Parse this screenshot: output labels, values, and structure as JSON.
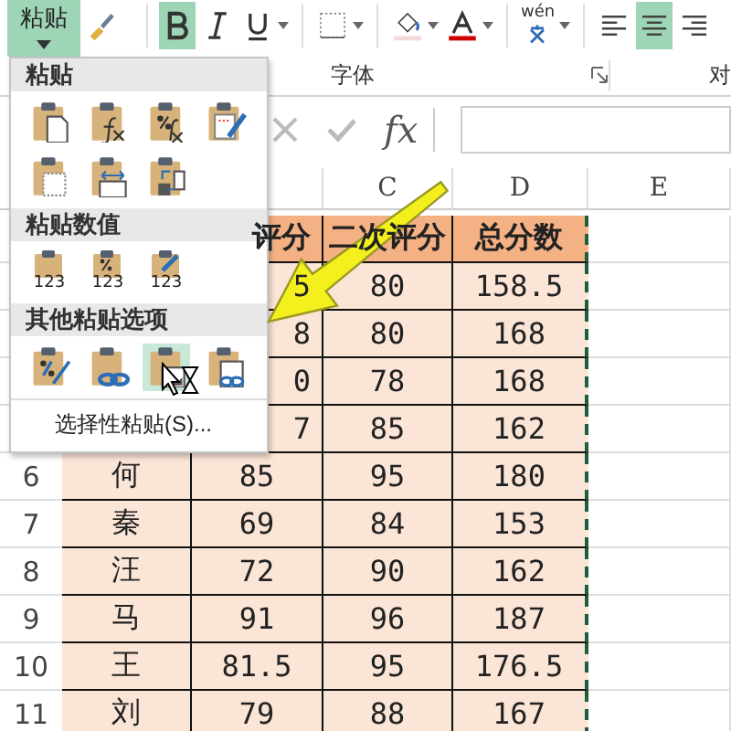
{
  "ribbon": {
    "paste_button": {
      "label": "粘贴",
      "selected": true
    },
    "tools": [
      {
        "kind": "brush",
        "selected": false
      },
      {
        "kind": "bold",
        "selected": true
      },
      {
        "kind": "italic",
        "selected": false
      },
      {
        "kind": "underline",
        "selected": false
      },
      {
        "kind": "border",
        "selected": false
      },
      {
        "kind": "fill",
        "selected": false
      },
      {
        "kind": "font-color",
        "selected": false
      },
      {
        "kind": "phonetic",
        "label": "wén",
        "selected": false
      },
      {
        "kind": "align-left",
        "selected": false
      },
      {
        "kind": "align-center",
        "selected": true
      },
      {
        "kind": "align-right",
        "selected": false
      }
    ],
    "groups": [
      {
        "label": "字体",
        "launcher": true
      },
      {
        "label": "对",
        "launcher": false
      }
    ]
  },
  "formula_bar": {
    "fx": "fx"
  },
  "sheet": {
    "columns": [
      null,
      null,
      "C",
      "D",
      "E"
    ],
    "rows": [
      {
        "number": null,
        "cells": [
          null,
          "评分",
          "二次评分",
          "总分数"
        ],
        "kind": "header"
      },
      {
        "number": null,
        "cells": [
          null,
          "5",
          "80",
          "158.5"
        ],
        "kind": "data"
      },
      {
        "number": null,
        "cells": [
          null,
          "8",
          "80",
          "168"
        ],
        "kind": "data"
      },
      {
        "number": null,
        "cells": [
          null,
          "0",
          "78",
          "168"
        ],
        "kind": "data"
      },
      {
        "number": null,
        "cells": [
          null,
          "7",
          "85",
          "162"
        ],
        "kind": "data"
      },
      {
        "number": "6",
        "cells": [
          "何",
          "85",
          "95",
          "180"
        ],
        "kind": "data"
      },
      {
        "number": "7",
        "cells": [
          "秦",
          "69",
          "84",
          "153"
        ],
        "kind": "data"
      },
      {
        "number": "8",
        "cells": [
          "汪",
          "72",
          "90",
          "162"
        ],
        "kind": "data"
      },
      {
        "number": "9",
        "cells": [
          "马",
          "91",
          "96",
          "187"
        ],
        "kind": "data"
      },
      {
        "number": "10",
        "cells": [
          "王",
          "81.5",
          "95",
          "176.5"
        ],
        "kind": "data"
      },
      {
        "number": "11",
        "cells": [
          "刘",
          "79",
          "88",
          "167"
        ],
        "kind": "data"
      }
    ]
  },
  "paste_menu": {
    "sections": [
      {
        "title": "粘贴",
        "options": [
          {
            "kind": "all",
            "selected": false
          },
          {
            "kind": "formulas",
            "selected": false
          },
          {
            "kind": "formulas-number",
            "selected": false
          },
          {
            "kind": "keep-format",
            "selected": false
          },
          {
            "kind": "no-border",
            "selected": false
          },
          {
            "kind": "column-width",
            "selected": false
          },
          {
            "kind": "transpose",
            "selected": false
          }
        ]
      },
      {
        "title": "粘贴数值",
        "options": [
          {
            "kind": "values",
            "label": "123",
            "selected": false
          },
          {
            "kind": "values-number",
            "label": "123",
            "selected": false
          },
          {
            "kind": "values-format",
            "label": "123",
            "selected": false
          }
        ]
      },
      {
        "title": "其他粘贴选项",
        "options": [
          {
            "kind": "formatting",
            "selected": false
          },
          {
            "kind": "link",
            "selected": false
          },
          {
            "kind": "picture",
            "selected": true
          },
          {
            "kind": "linked-picture",
            "selected": false
          }
        ]
      }
    ],
    "footer": "选择性粘贴(S)..."
  }
}
